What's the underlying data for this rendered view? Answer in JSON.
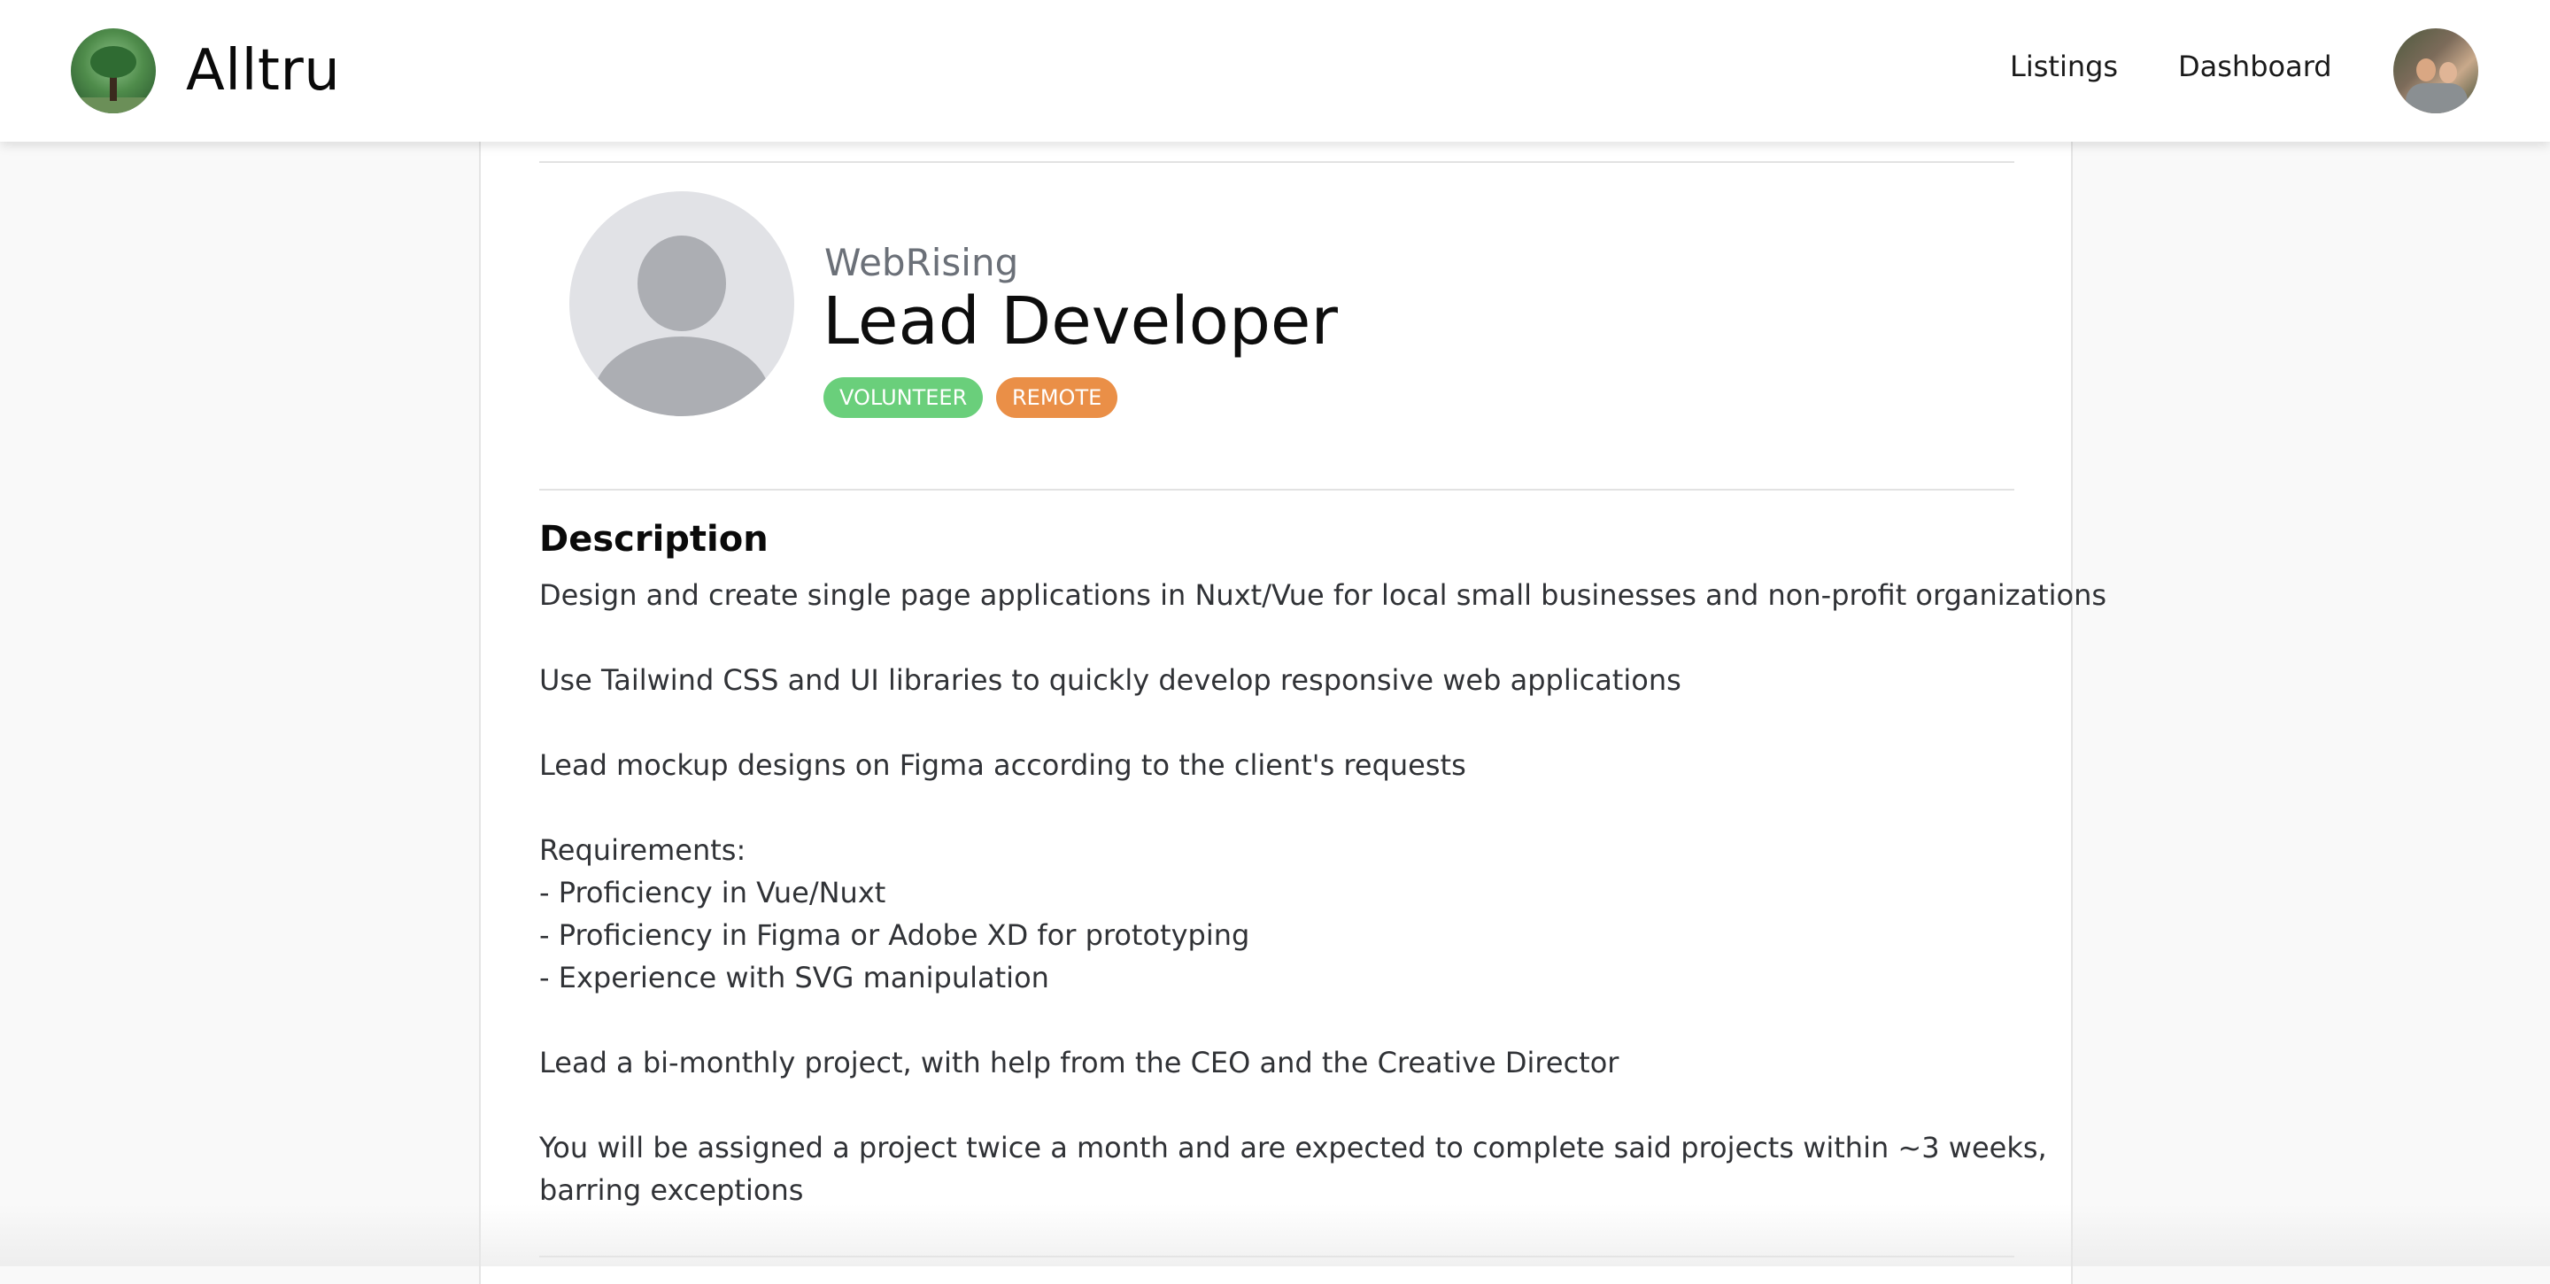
{
  "nav": {
    "brand": "Alltru",
    "logo_icon": "tree-logo-icon",
    "links": [
      "Listings",
      "Dashboard"
    ],
    "avatar_icon": "user-avatar-photo"
  },
  "listing": {
    "organization": "WebRising",
    "title": "Lead Developer",
    "org_avatar_icon": "placeholder-person-icon",
    "badges": [
      {
        "label": "VOLUNTEER",
        "color": "#6acf7b"
      },
      {
        "label": "REMOTE",
        "color": "#ea8f47"
      }
    ]
  },
  "description": {
    "heading": "Description",
    "lines": [
      "Design and create single page applications in Nuxt/Vue for local small businesses and non-profit organizations",
      "",
      "Use Tailwind CSS and UI libraries to quickly develop responsive web applications",
      "",
      "Lead mockup designs on Figma according to the client's requests",
      "",
      "Requirements:",
      "- Proficiency in Vue/Nuxt",
      "- Proficiency in Figma or Adobe XD for prototyping",
      "- Experience with SVG manipulation",
      "",
      "Lead a bi-monthly project, with help from the CEO and the Creative Director",
      "",
      "You will be assigned a project twice a month and are expected to complete said projects within ~3 weeks,",
      "barring exceptions"
    ]
  },
  "colors": {
    "volunteer_badge": "#6acf7b",
    "remote_badge": "#ea8f47",
    "org_name": "#6b7078",
    "page_background": "#f9f9f9"
  }
}
